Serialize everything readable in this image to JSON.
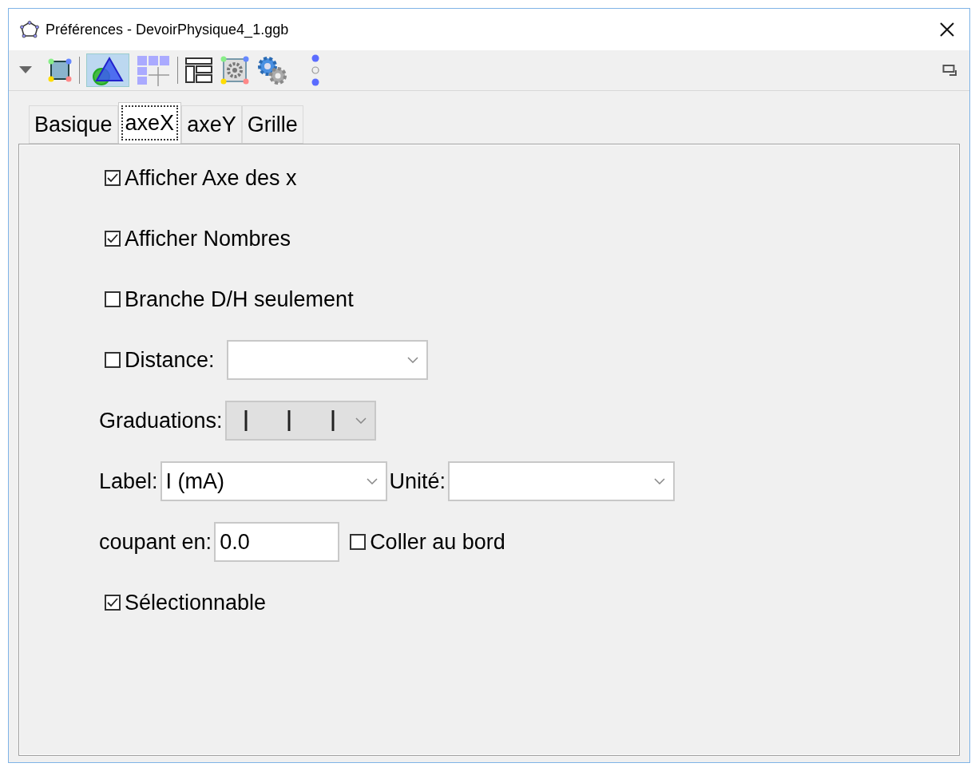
{
  "window": {
    "title": "Préférences - DevoirPhysique4_1.ggb"
  },
  "tabs": [
    {
      "label": "Basique",
      "selected": false
    },
    {
      "label": "axeX",
      "selected": true
    },
    {
      "label": "axeY",
      "selected": false
    },
    {
      "label": "Grille",
      "selected": false
    }
  ],
  "rows": [
    {
      "items": [
        {
          "kind": "checkbox",
          "label": "Afficher Axe des x",
          "checked": true
        }
      ]
    },
    {
      "items": [
        {
          "kind": "checkbox",
          "label": "Afficher Nombres",
          "checked": true
        }
      ]
    },
    {
      "items": [
        {
          "kind": "checkbox",
          "label": "Branche D/H seulement",
          "checked": false
        }
      ]
    },
    {
      "items": [
        {
          "kind": "checkbox",
          "label": "Distance:",
          "checked": false
        },
        {
          "kind": "dropdown",
          "disabled": false
        }
      ]
    },
    {
      "items": [
        {
          "kind": "label",
          "label": "Graduations:"
        },
        {
          "kind": "ticks_dropdown",
          "disabled": true
        }
      ]
    },
    {
      "items": [
        {
          "kind": "label",
          "label": "Label:"
        },
        {
          "kind": "dropdown",
          "value": "I (mA)",
          "disabled": false
        },
        {
          "kind": "label",
          "label": "Unité:"
        },
        {
          "kind": "dropdown",
          "disabled": false
        }
      ]
    },
    {
      "items": [
        {
          "kind": "label",
          "label": "coupant en:"
        },
        {
          "kind": "input",
          "value": "0.0"
        },
        {
          "kind": "checkbox",
          "label": "Coller au bord",
          "checked": false
        }
      ]
    },
    {
      "items": [
        {
          "kind": "checkbox",
          "label": "Sélectionnable",
          "checked": true
        }
      ]
    }
  ]
}
